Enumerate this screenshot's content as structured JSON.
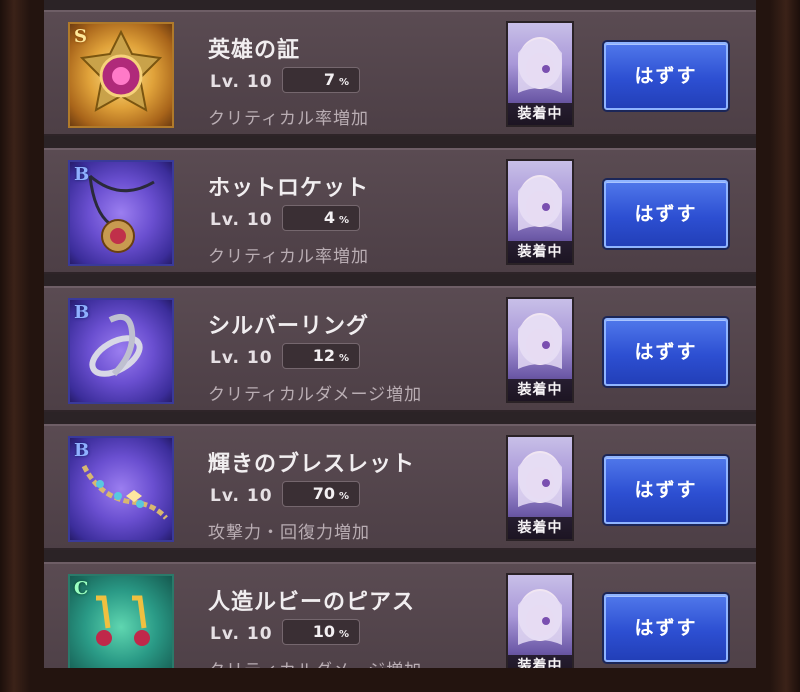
{
  "equip_label": "装着中",
  "unequip_label": "はずす",
  "items": [
    {
      "rank": "S",
      "rank_class": "s",
      "icon": "gem-crest-icon",
      "name": "英雄の証",
      "level": "Lv. 10",
      "value": "7",
      "unit": "%",
      "effect": "クリティカル率増加"
    },
    {
      "rank": "B",
      "rank_class": "b",
      "icon": "locket-pendant-icon",
      "name": "ホットロケット",
      "level": "Lv. 10",
      "value": "4",
      "unit": "%",
      "effect": "クリティカル率増加"
    },
    {
      "rank": "B",
      "rank_class": "b",
      "icon": "silver-ring-icon",
      "name": "シルバーリング",
      "level": "Lv. 10",
      "value": "12",
      "unit": "%",
      "effect": "クリティカルダメージ増加"
    },
    {
      "rank": "B",
      "rank_class": "b",
      "icon": "bracelet-icon",
      "name": "輝きのブレスレット",
      "level": "Lv. 10",
      "value": "70",
      "unit": "%",
      "effect": "攻撃力・回復力増加"
    },
    {
      "rank": "C",
      "rank_class": "c",
      "icon": "ruby-earrings-icon",
      "name": "人造ルビーのピアス",
      "level": "Lv. 10",
      "value": "10",
      "unit": "%",
      "effect": "クリティカルダメージ増加"
    }
  ]
}
